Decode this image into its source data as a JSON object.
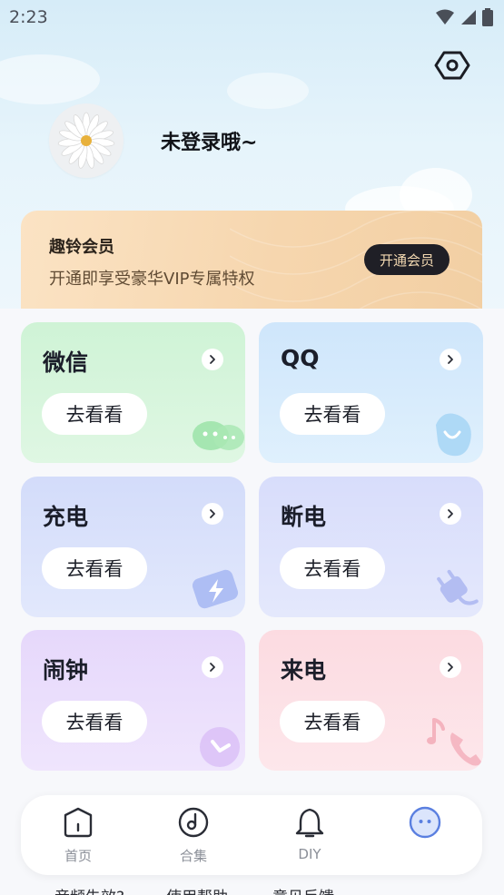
{
  "status_bar": {
    "time": "2:23"
  },
  "profile": {
    "login_text": "未登录哦~"
  },
  "vip": {
    "title": "趣铃会员",
    "subtitle": "开通即享受豪华VIP专属特权",
    "button": "开通会员"
  },
  "cards": [
    {
      "title": "微信",
      "button": "去看看"
    },
    {
      "title": "QQ",
      "button": "去看看"
    },
    {
      "title": "充电",
      "button": "去看看"
    },
    {
      "title": "断电",
      "button": "去看看"
    },
    {
      "title": "闹钟",
      "button": "去看看"
    },
    {
      "title": "来电",
      "button": "去看看"
    }
  ],
  "hidden_row": [
    "音频失效?",
    "使用帮助",
    "意见反馈"
  ],
  "nav": [
    {
      "label": "首页",
      "icon": "home-icon"
    },
    {
      "label": "合集",
      "icon": "music-disc-icon"
    },
    {
      "label": "DIY",
      "icon": "bell-icon"
    },
    {
      "label": "",
      "icon": "profile-face-icon"
    }
  ],
  "colors": {
    "vip_button_bg": "#1f1f26",
    "vip_button_text": "#f3d9b2",
    "nav_active": "#5a7fe0",
    "nav_inactive": "#8b8f98"
  }
}
